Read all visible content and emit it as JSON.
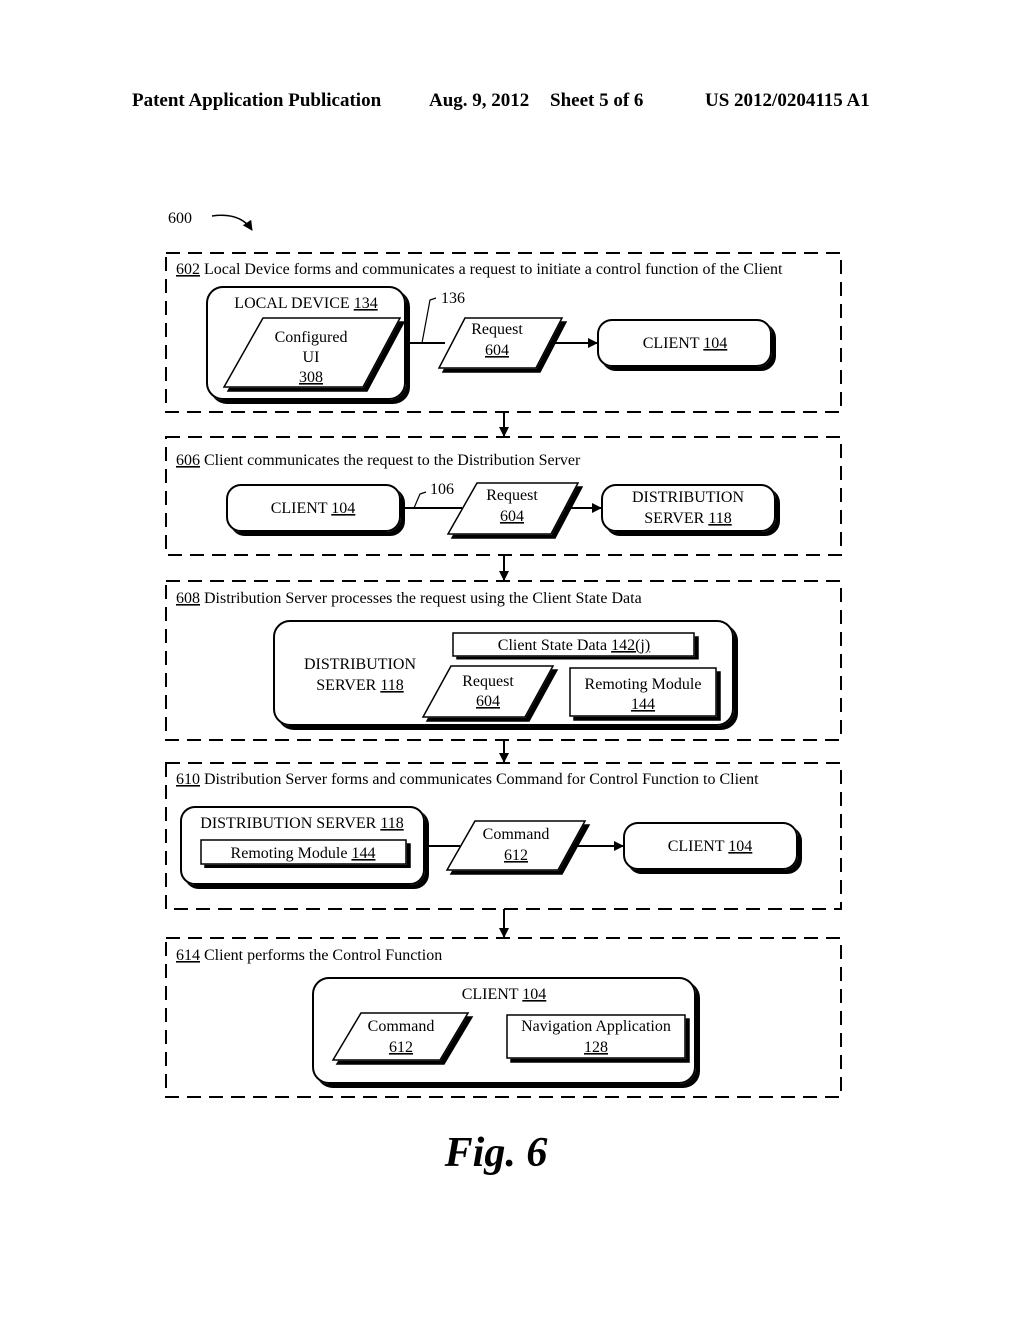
{
  "header": {
    "publication": "Patent Application Publication",
    "date": "Aug. 9, 2012",
    "sheet": "Sheet 5 of 6",
    "number": "US 2012/0204115 A1"
  },
  "figure": {
    "ref": "600",
    "caption": "Fig. 6"
  },
  "steps": [
    {
      "ref": "602",
      "title": " Local Device forms and communicates a request to initiate a control function of the Client",
      "nodes": {
        "local_device": {
          "label": "LOCAL DEVICE ",
          "ref": "134"
        },
        "configured_ui": {
          "line1": "Configured",
          "line2": "UI",
          "ref": "308"
        },
        "link_ref": "136",
        "request": {
          "label": "Request",
          "ref": "604"
        },
        "client": {
          "label": "CLIENT ",
          "ref": "104"
        }
      }
    },
    {
      "ref": "606",
      "title": " Client communicates the request to the Distribution Server",
      "nodes": {
        "client": {
          "label": "CLIENT ",
          "ref": "104"
        },
        "link_ref": "106",
        "request": {
          "label": "Request",
          "ref": "604"
        },
        "server": {
          "line1": "DISTRIBUTION",
          "label": "SERVER ",
          "ref": "118"
        }
      }
    },
    {
      "ref": "608",
      "title": " Distribution Server processes the request using the Client State Data",
      "nodes": {
        "server": {
          "line1": "DISTRIBUTION",
          "label": "SERVER ",
          "ref": "118"
        },
        "state_data": {
          "label": "Client State Data ",
          "ref": "142(j)"
        },
        "request": {
          "label": "Request",
          "ref": "604"
        },
        "remoting": {
          "label": "Remoting Module",
          "ref": "144"
        }
      }
    },
    {
      "ref": "610",
      "title": " Distribution Server forms and communicates Command for Control Function to Client",
      "nodes": {
        "server": {
          "label": "DISTRIBUTION SERVER ",
          "ref": "118"
        },
        "remoting": {
          "label": "Remoting Module ",
          "ref": "144"
        },
        "command": {
          "label": "Command",
          "ref": "612"
        },
        "client": {
          "label": "CLIENT ",
          "ref": "104"
        }
      }
    },
    {
      "ref": "614",
      "title": " Client performs the Control Function",
      "nodes": {
        "client": {
          "label": "CLIENT ",
          "ref": "104"
        },
        "command": {
          "label": "Command",
          "ref": "612"
        },
        "nav_app": {
          "label": "Navigation Application",
          "ref": "128"
        }
      }
    }
  ]
}
